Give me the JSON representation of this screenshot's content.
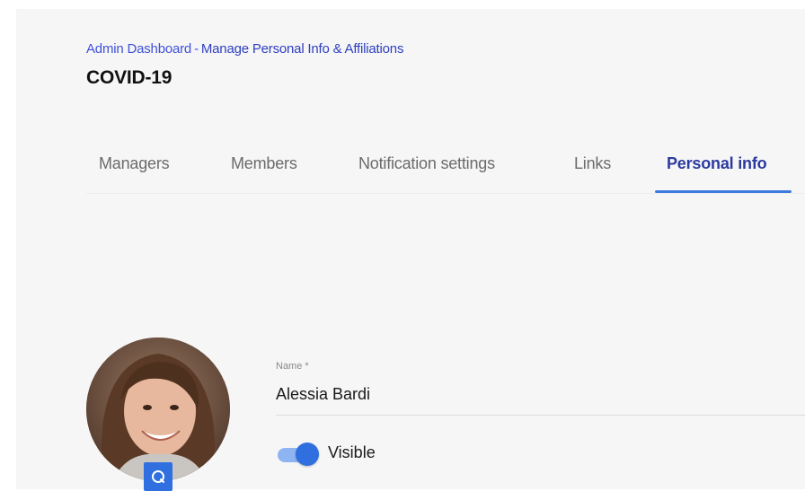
{
  "breadcrumb": {
    "parent": "Admin Dashboard",
    "separator": "-",
    "current": "Manage Personal Info & Affiliations"
  },
  "page": {
    "title": "COVID-19"
  },
  "tabs": [
    {
      "label": "Managers"
    },
    {
      "label": "Members"
    },
    {
      "label": "Notification settings"
    },
    {
      "label": "Links"
    },
    {
      "label": "Personal info",
      "active": true
    }
  ],
  "profile": {
    "avatar_icon": "profile-photo",
    "edit_icon": "camera-icon",
    "name_label": "Name *",
    "name_value": "Alessia Bardi",
    "visibility_label": "Visible",
    "visible": true
  },
  "colors": {
    "accent": "#2f6fe0",
    "link": "#3f51d9",
    "active_tab": "#2b3a9f"
  }
}
